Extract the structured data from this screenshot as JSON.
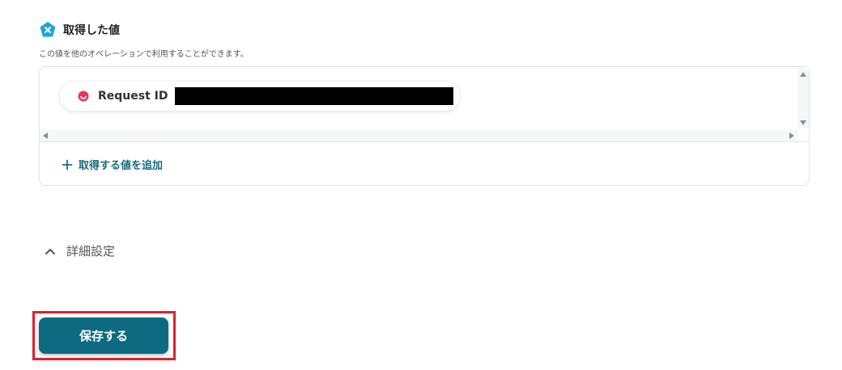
{
  "section": {
    "title": "取得した値",
    "description": "この値を他のオペレーションで利用することができます。"
  },
  "values": [
    {
      "label": "Request ID",
      "value": "",
      "value_redacted": true
    }
  ],
  "add_button": {
    "label": "取得する値を追加"
  },
  "advanced": {
    "label": "詳細設定",
    "expanded": true
  },
  "save_button": {
    "label": "保存する"
  },
  "icons": {
    "section": "x-badge-icon",
    "chip": "app-logo-icon",
    "add": "plus-icon",
    "advanced": "chevron-up-icon"
  },
  "colors": {
    "accent": "#0d6a80",
    "link": "#1b6b80",
    "badge": "#1aa6d8",
    "chip_logo": "#e8375a",
    "highlight": "#e0202a"
  }
}
